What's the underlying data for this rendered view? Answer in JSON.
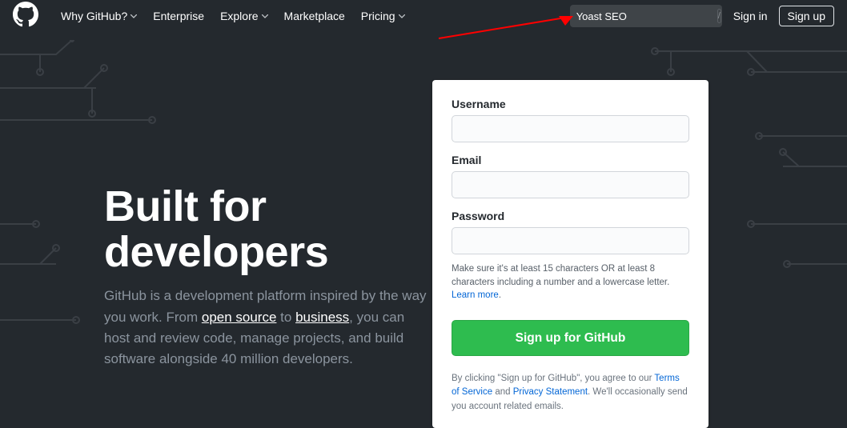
{
  "header": {
    "nav": [
      {
        "label": "Why GitHub?",
        "caret": true
      },
      {
        "label": "Enterprise",
        "caret": false
      },
      {
        "label": "Explore",
        "caret": true
      },
      {
        "label": "Marketplace",
        "caret": false
      },
      {
        "label": "Pricing",
        "caret": true
      }
    ],
    "search_value": "Yoast SEO",
    "slash": "/",
    "signin": "Sign in",
    "signup": "Sign up"
  },
  "hero": {
    "title_line1": "Built for",
    "title_line2": "developers",
    "blurb_1": "GitHub is a development platform inspired by the way you work. From ",
    "blurb_open_source": "open source",
    "blurb_2": " to ",
    "blurb_business": "business",
    "blurb_3": ", you can host and review code, manage projects, and build software alongside 40 million developers."
  },
  "form": {
    "username_label": "Username",
    "email_label": "Email",
    "password_label": "Password",
    "hint_1": "Make sure it's at least 15 characters OR at least 8 characters including a number and a lowercase letter. ",
    "hint_learn": "Learn more",
    "hint_dot": ".",
    "submit": "Sign up for GitHub",
    "legal_1": "By clicking \"Sign up for GitHub\", you agree to our ",
    "legal_tos": "Terms of Service",
    "legal_2": " and ",
    "legal_priv": "Privacy Statement",
    "legal_3": ". We'll occasionally send you account related emails."
  }
}
